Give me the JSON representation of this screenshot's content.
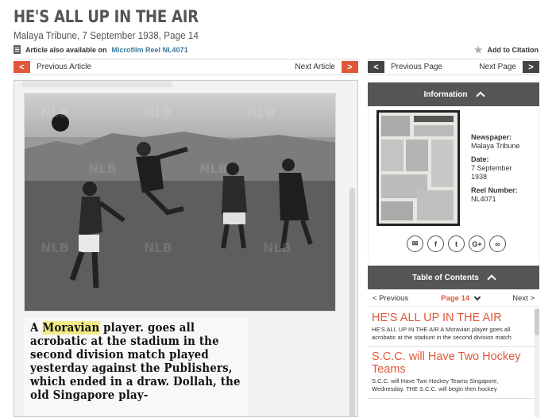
{
  "article": {
    "title": "HE'S ALL UP IN THE AIR",
    "source": "Malaya Tribune, 7 September 1938, Page 14",
    "reel_prefix": "Article also available on",
    "reel_link": "Microfilm Reel NL4071",
    "add_citation": "Add to Citation"
  },
  "nav": {
    "prev_article": "Previous Article",
    "next_article": "Next Article",
    "prev_page": "Previous Page",
    "next_page": "Next Page"
  },
  "viewer": {
    "text_before": "A ",
    "highlight": "Moravian",
    "text_after": " player. goes all acrobatic at the stadium in the second division match played yesterday against the Publishers, which ended in a draw. Dollah, the old Singapore play-"
  },
  "information": {
    "header": "Information",
    "newspaper_label": "Newspaper:",
    "newspaper_value": "Malaya Tribune",
    "date_label": "Date:",
    "date_value": "7 September 1938",
    "reel_label": "Reel Number:",
    "reel_value": "NL4071",
    "share_icons": [
      "email-icon",
      "facebook-icon",
      "twitter-icon",
      "google-plus-icon",
      "link-icon"
    ]
  },
  "toc": {
    "header": "Table of Contents",
    "previous": "< Previous",
    "page": "Page 14",
    "next": "Next >",
    "items": [
      {
        "title": "HE'S ALL UP IN THE AIR",
        "desc": "HE'S ALL UP IN THE AIR A Moravian player goes all acrobatic at the stadium in the second division match"
      },
      {
        "title": "S.C.C. will Have Two Hockey Teams",
        "desc": "S.C.C. will Have Two Hockey Teams Singapore, Wednesday. THE S.C.C. will begin then hockey"
      }
    ]
  },
  "colors": {
    "accent": "#e0573a",
    "panel": "#555555",
    "link": "#3a7a9a"
  }
}
